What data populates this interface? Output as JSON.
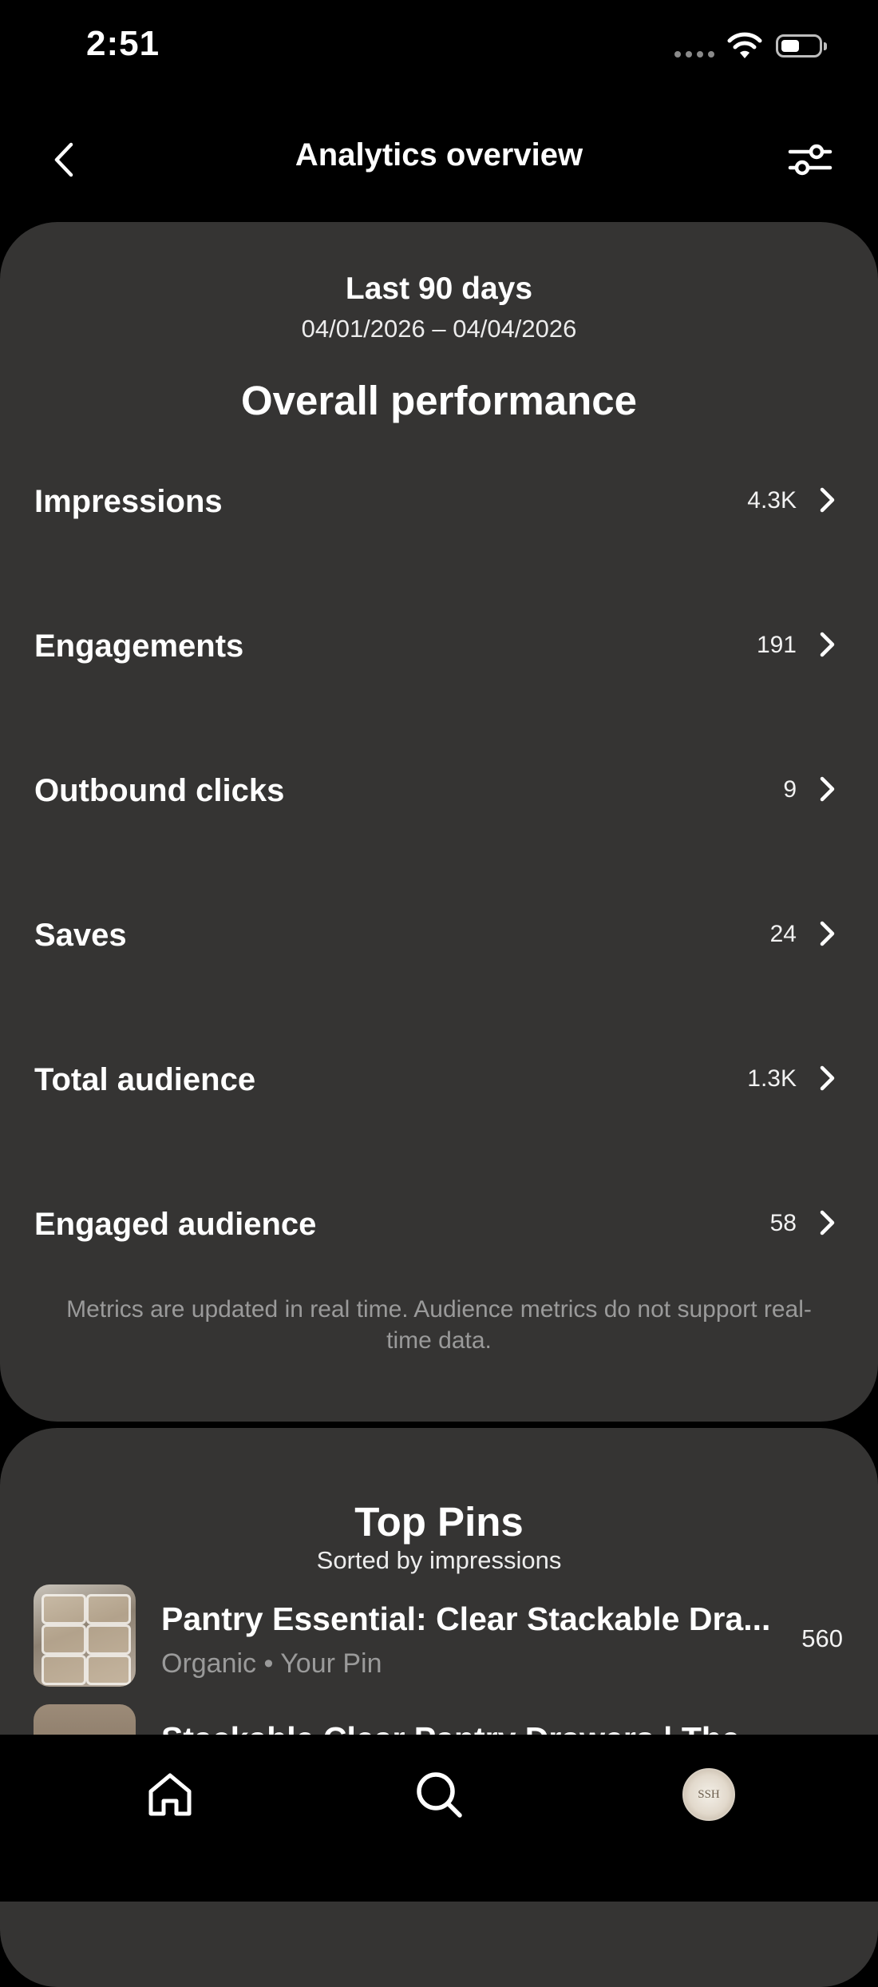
{
  "status_bar": {
    "time": "2:51"
  },
  "header": {
    "title": "Analytics overview",
    "back_icon": "chevron-left-icon",
    "filter_icon": "sliders-icon"
  },
  "performance": {
    "range_title": "Last 90 days",
    "range_dates": "04/01/2026 – 04/04/2026",
    "title": "Overall performance",
    "metrics": [
      {
        "label": "Impressions",
        "value": "4.3K"
      },
      {
        "label": "Engagements",
        "value": "191"
      },
      {
        "label": "Outbound clicks",
        "value": "9"
      },
      {
        "label": "Saves",
        "value": "24"
      },
      {
        "label": "Total audience",
        "value": "1.3K"
      },
      {
        "label": "Engaged audience",
        "value": "58"
      }
    ],
    "note": "Metrics are updated in real time. Audience metrics do not support real-time data."
  },
  "top_pins": {
    "title": "Top Pins",
    "subtitle": "Sorted by impressions",
    "pins": [
      {
        "title": "Pantry Essential: Clear Stackable Dra...",
        "meta": "Organic • Your Pin",
        "value": "560"
      },
      {
        "title": "Stackable Clear Pantry Drawers | The",
        "meta": "",
        "value": ""
      }
    ]
  },
  "bottom_nav": {
    "items": [
      "home-icon",
      "search-icon",
      "avatar"
    ],
    "avatar_text": "SSH"
  },
  "colors": {
    "background": "#000000",
    "card": "#353433",
    "muted_text": "#9a9a9a"
  }
}
